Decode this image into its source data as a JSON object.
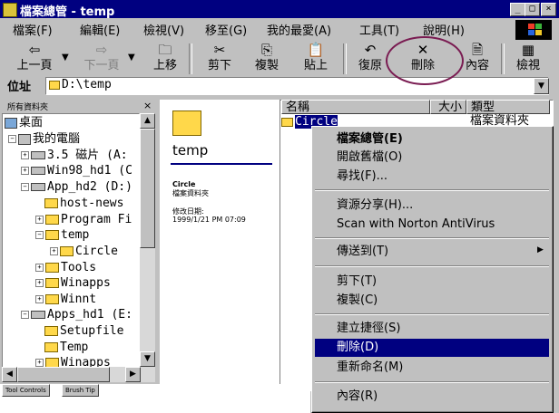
{
  "window": {
    "title": "檔案總管 - temp",
    "controls": [
      "_",
      "□",
      "×"
    ]
  },
  "menu": [
    "檔案(F)",
    "編輯(E)",
    "檢視(V)",
    "移至(G)",
    "我的最愛(A)",
    "工具(T)",
    "說明(H)"
  ],
  "toolbar": {
    "back": "上一頁",
    "forward": "下一頁",
    "up": "上移",
    "cut": "剪下",
    "copy": "複製",
    "paste": "貼上",
    "undo": "復原",
    "delete": "刪除",
    "properties": "內容",
    "views": "檢視"
  },
  "address": {
    "label": "位址",
    "value": "D:\\temp"
  },
  "folder_pane": {
    "header": "所有資料夾",
    "close": "×",
    "nodes": [
      "桌面",
      "我的電腦",
      "3.5 磁片 (A:",
      "Win98_hd1 (C",
      "App_hd2 (D:)",
      "host-news",
      "Program Fi",
      "temp",
      "Circle",
      "Tools",
      "Winapps",
      "Winnt",
      "Apps_hd1 (E:",
      "Setupfile",
      "Temp",
      "Winapps"
    ]
  },
  "webview": {
    "title": "temp",
    "item_name": "Circle",
    "item_type": "檔案資料夾",
    "modified_label": "修改日期:",
    "modified_value": "1999/1/21 PM 07:09"
  },
  "filelist": {
    "columns": [
      "名稱",
      "大小",
      "類型"
    ],
    "rows": [
      {
        "name": "Circle",
        "type": "檔案資料夾"
      }
    ]
  },
  "context_menu": {
    "items": [
      "檔案總管(E)",
      "開啟舊檔(O)",
      "尋找(F)...",
      "資源分享(H)...",
      "Scan with Norton AntiVirus",
      "傳送到(T)",
      "剪下(T)",
      "複製(C)",
      "建立捷徑(S)",
      "刪除(D)",
      "重新命名(M)",
      "內容(R)"
    ],
    "highlighted": "刪除(D)"
  },
  "bottom_tabs": [
    "Tool Controls",
    "Brush Tip"
  ],
  "colors": {
    "titlebar": "#000080",
    "highlight": "#000080",
    "face": "#c0c0c0",
    "annotation": "#7a1c52"
  }
}
